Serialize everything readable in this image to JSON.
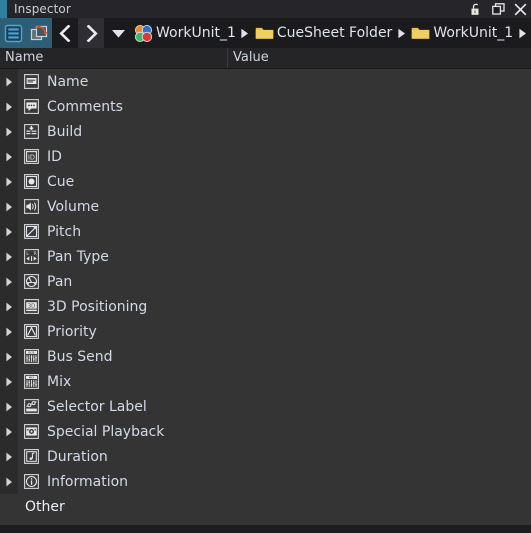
{
  "window": {
    "title": "Inspector",
    "accent_color": "#2f7f9e",
    "background": "#343434",
    "buttons": [
      {
        "name": "lock-button",
        "icon": "lock-icon",
        "label": "Lock"
      },
      {
        "name": "float-button",
        "icon": "float-icon",
        "label": "Float"
      },
      {
        "name": "close-button",
        "icon": "close-icon",
        "label": "Close"
      }
    ]
  },
  "toolbar": {
    "tools": [
      {
        "name": "list-view-button",
        "icon": "list-icon",
        "label": "List View",
        "selected": true
      },
      {
        "name": "sync-button",
        "icon": "sync-icon",
        "label": "Sync",
        "selected": true
      }
    ],
    "nav": [
      {
        "name": "back-button",
        "icon": "chevron-left-icon",
        "label": "Back",
        "highlighted": false
      },
      {
        "name": "forward-button",
        "icon": "chevron-right-icon",
        "label": "Forward",
        "highlighted": true
      },
      {
        "name": "history-button",
        "icon": "triangle-down-icon",
        "label": "History",
        "highlighted": false
      }
    ],
    "breadcrumb": [
      {
        "label": "WorkUnit_1",
        "icon": "workunit-icon"
      },
      {
        "label": "CueSheet Folder",
        "icon": "folder-icon"
      },
      {
        "label": "WorkUnit_1",
        "icon": "folder-icon"
      }
    ],
    "breadcrumb_trailing_separator": true
  },
  "columns": [
    {
      "key": "name",
      "label": "Name"
    },
    {
      "key": "value",
      "label": "Value"
    }
  ],
  "rows": [
    {
      "label": "Name",
      "icon": "name-field-icon",
      "expandable": true
    },
    {
      "label": "Comments",
      "icon": "comment-balloon-icon",
      "expandable": true
    },
    {
      "label": "Build",
      "icon": "build-icon",
      "expandable": true
    },
    {
      "label": "ID",
      "icon": "id-icon",
      "expandable": true
    },
    {
      "label": "Cue",
      "icon": "cue-icon",
      "expandable": true
    },
    {
      "label": "Volume",
      "icon": "speaker-icon",
      "expandable": true
    },
    {
      "label": "Pitch",
      "icon": "pitch-icon",
      "expandable": true
    },
    {
      "label": "Pan Type",
      "icon": "pan-type-icon",
      "expandable": true
    },
    {
      "label": "Pan",
      "icon": "pan-icon",
      "expandable": true
    },
    {
      "label": "3D Positioning",
      "icon": "three-d-icon",
      "expandable": true
    },
    {
      "label": "Priority",
      "icon": "priority-icon",
      "expandable": true
    },
    {
      "label": "Bus Send",
      "icon": "bus-send-icon",
      "expandable": true
    },
    {
      "label": "Mix",
      "icon": "mix-icon",
      "expandable": true
    },
    {
      "label": "Selector Label",
      "icon": "selector-label-icon",
      "expandable": true
    },
    {
      "label": "Special Playback",
      "icon": "special-playback-icon",
      "expandable": true
    },
    {
      "label": "Duration",
      "icon": "duration-icon",
      "expandable": true
    },
    {
      "label": "Information",
      "icon": "information-icon",
      "expandable": true
    },
    {
      "label": "Other",
      "icon": null,
      "expandable": false
    }
  ]
}
